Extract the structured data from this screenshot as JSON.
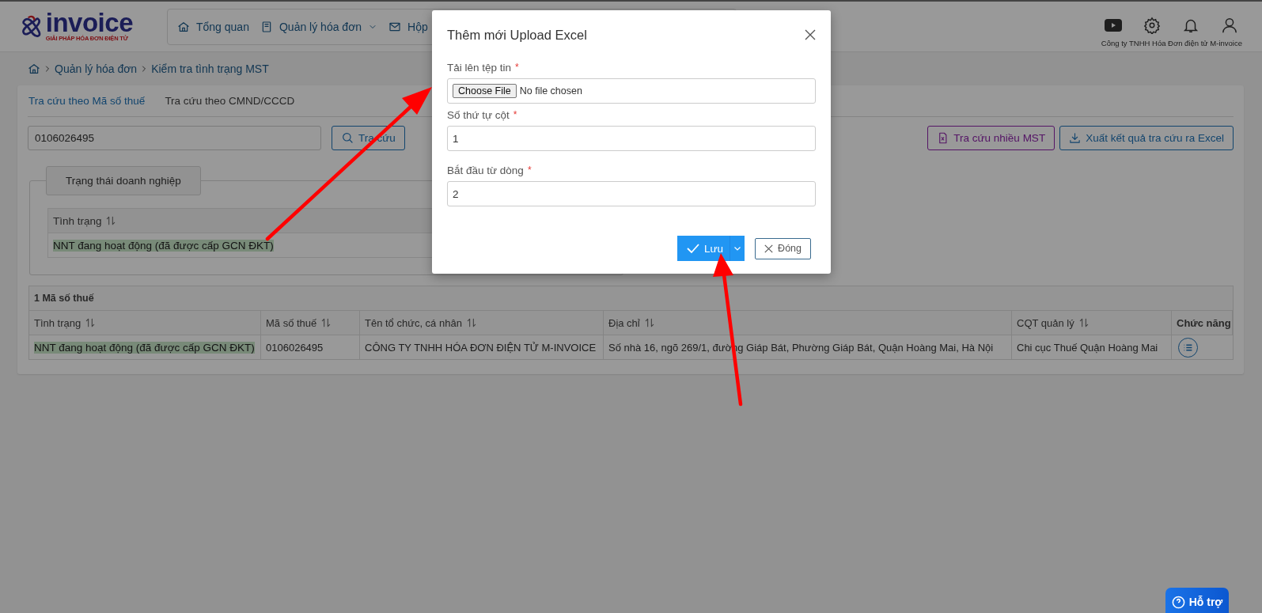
{
  "header": {
    "logo": {
      "word": "invoice",
      "tagline": "GIẢI PHÁP HÓA ĐƠN ĐIỆN TỬ"
    },
    "nav": [
      {
        "label": "Tổng quan",
        "dropdown": false
      },
      {
        "label": "Quản lý hóa đơn",
        "dropdown": true
      },
      {
        "label": "Hộp",
        "dropdown": false
      }
    ],
    "company": "Công ty TNHH Hóa Đơn điện tử M-invoice"
  },
  "breadcrumb": [
    "Quản lý hóa đơn",
    "Kiểm tra tình trạng MST"
  ],
  "tabs": [
    {
      "label": "Tra cứu theo Mã số thuế",
      "selected": true
    },
    {
      "label": "Tra cứu theo CMND/CCCD",
      "selected": false
    }
  ],
  "search": {
    "value": "0106026495",
    "button": "Tra cứu"
  },
  "actions": [
    {
      "label": "Tra cứu nhiều MST",
      "kind": "excel"
    },
    {
      "label": "Xuất kết quả tra cứu ra Excel",
      "kind": "download"
    }
  ],
  "status_panel": {
    "legend": "Trạng thái doanh nghiệp",
    "column": "Tình trạng",
    "value": "NNT đang hoạt động (đã được cấp GCN ĐKT)"
  },
  "table": {
    "caption": "1 Mã số thuế",
    "columns": [
      {
        "label": "Tình trạng",
        "sortable": true
      },
      {
        "label": "Mã số thuế",
        "sortable": true
      },
      {
        "label": "Tên tổ chức, cá nhân",
        "sortable": true
      },
      {
        "label": "Địa chỉ",
        "sortable": true
      },
      {
        "label": "CQT quản lý",
        "sortable": true
      },
      {
        "label": "Chức năng",
        "sortable": false
      }
    ],
    "rows": [
      {
        "status": "NNT đang hoạt động (đã được cấp GCN ĐKT)",
        "tax_code": "0106026495",
        "name": "CÔNG TY TNHH HÓA ĐƠN ĐIỆN TỬ M-INVOICE",
        "address": "Số nhà 16, ngõ 269/1, đường Giáp Bát, Phường Giáp Bát, Quận Hoàng Mai, Hà Nội",
        "authority": "Chi cục Thuế Quận Hoàng Mai"
      }
    ]
  },
  "modal": {
    "title": "Thêm mới Upload Excel",
    "fields": [
      {
        "kind": "file",
        "label": "Tải lên tệp tin",
        "mark": "*",
        "button": "Choose File",
        "value": "No file chosen"
      },
      {
        "kind": "text",
        "label": "Số thứ tự cột",
        "mark": "*",
        "value": "1"
      },
      {
        "kind": "text",
        "label": "Bắt đầu từ dòng",
        "mark": "*",
        "value": "2"
      }
    ],
    "save": "Lưu",
    "close": "Đóng"
  },
  "help": "Hỗ trợ"
}
